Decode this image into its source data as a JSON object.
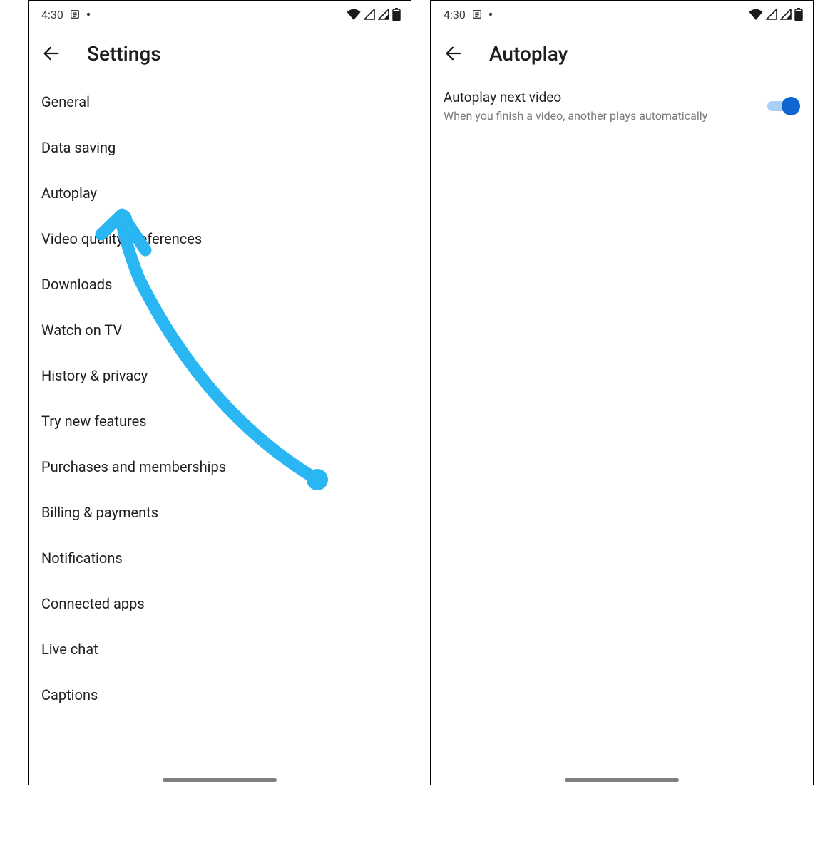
{
  "status": {
    "time": "4:30"
  },
  "left": {
    "title": "Settings",
    "items": [
      "General",
      "Data saving",
      "Autoplay",
      "Video quality preferences",
      "Downloads",
      "Watch on TV",
      "History & privacy",
      "Try new features",
      "Purchases and memberships",
      "Billing & payments",
      "Notifications",
      "Connected apps",
      "Live chat",
      "Captions"
    ]
  },
  "right": {
    "title": "Autoplay",
    "setting": {
      "title": "Autoplay next video",
      "subtitle": "When you finish a video, another plays automatically",
      "enabled": true
    }
  },
  "annotation": {
    "color": "#29b6f2"
  }
}
